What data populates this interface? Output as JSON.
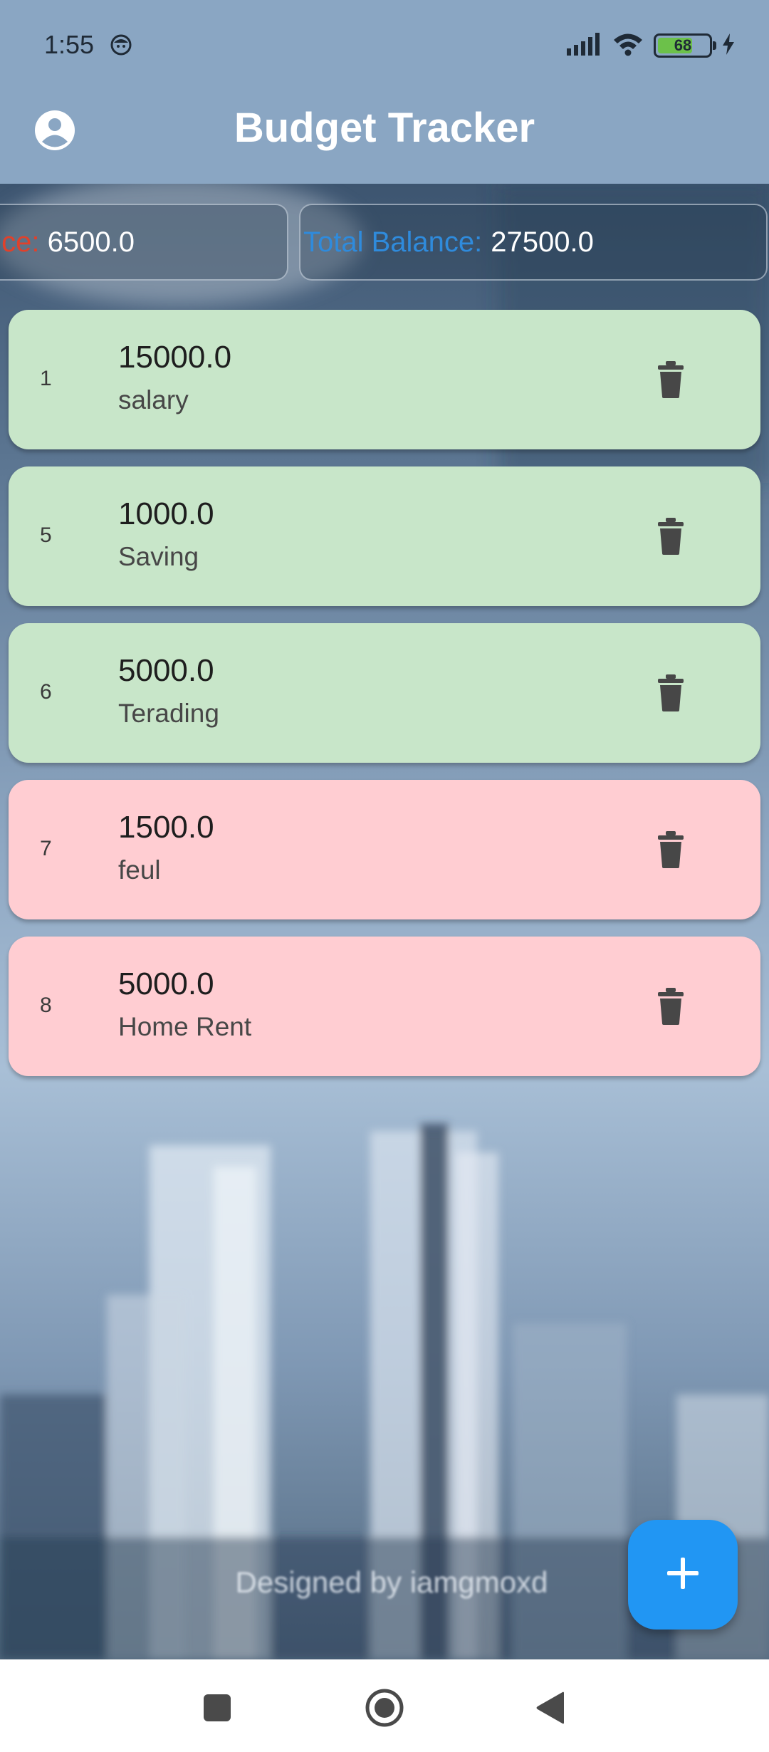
{
  "status_bar": {
    "time": "1:55",
    "battery_level": "68",
    "battery_fraction": 0.68,
    "icons": [
      "face-icon",
      "signal-icon",
      "wifi-icon",
      "battery-icon",
      "charging-icon"
    ]
  },
  "app_bar": {
    "title": "Budget Tracker",
    "avatar_icon": "account-circle-icon"
  },
  "summary": {
    "expense_label": "ce:",
    "expense_value": "6500.0",
    "balance_label": "Total Balance:",
    "balance_value": "27500.0"
  },
  "transactions": [
    {
      "index": "1",
      "amount": "15000.0",
      "description": "salary",
      "type": "income"
    },
    {
      "index": "5",
      "amount": "1000.0",
      "description": "Saving",
      "type": "income"
    },
    {
      "index": "6",
      "amount": "5000.0",
      "description": "Terading",
      "type": "income"
    },
    {
      "index": "7",
      "amount": "1500.0",
      "description": "feul",
      "type": "expense"
    },
    {
      "index": "8",
      "amount": "5000.0",
      "description": "Home Rent",
      "type": "expense"
    }
  ],
  "watermark": "Designed by iamgmoxd",
  "fab": {
    "icon": "plus-icon"
  },
  "colors": {
    "app_bar": "#8aa6c3",
    "income_card": "#c8e6c9",
    "expense_card": "#ffcdd2",
    "expense_label": "#e0412b",
    "balance_label": "#2f8bdc",
    "fab": "#2196f3"
  },
  "nav_bar": {
    "icons": [
      "recents-square-icon",
      "home-circle-icon",
      "back-triangle-icon"
    ]
  }
}
